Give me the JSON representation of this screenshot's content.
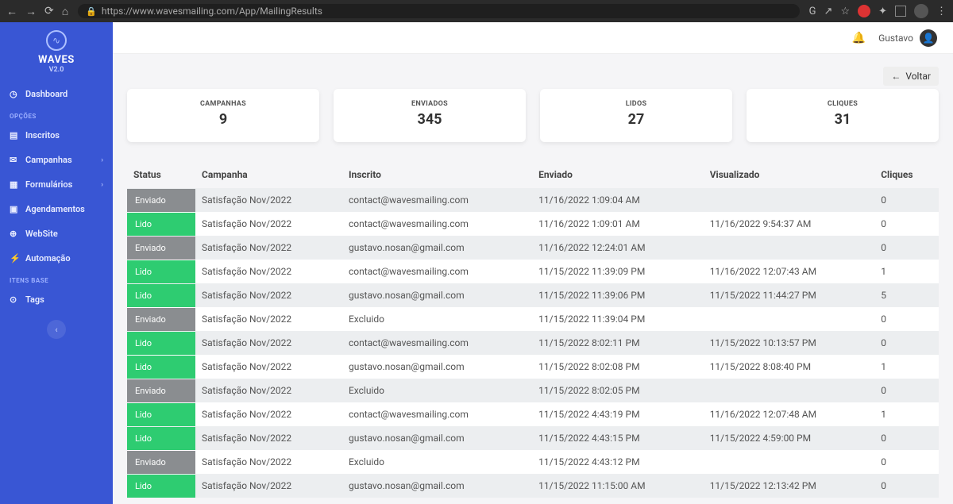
{
  "browser": {
    "url": "https://www.wavesmailing.com/App/MailingResults"
  },
  "brand": {
    "name": "WAVES",
    "version": "V2.0"
  },
  "sidebar": {
    "dashboard": "Dashboard",
    "section_opcoes": "OPÇÕES",
    "inscritos": "Inscritos",
    "campanhas": "Campanhas",
    "formularios": "Formulários",
    "agendamentos": "Agendamentos",
    "website": "WebSite",
    "automacao": "Automação",
    "section_itens": "ITENS BASE",
    "tags": "Tags"
  },
  "topbar": {
    "username": "Gustavo"
  },
  "back": {
    "label": "Voltar"
  },
  "stats": [
    {
      "label": "CAMPANHAS",
      "value": "9"
    },
    {
      "label": "ENVIADOS",
      "value": "345"
    },
    {
      "label": "LIDOS",
      "value": "27"
    },
    {
      "label": "CLIQUES",
      "value": "31"
    }
  ],
  "table": {
    "headers": {
      "status": "Status",
      "campanha": "Campanha",
      "inscrito": "Inscrito",
      "enviado": "Enviado",
      "visualizado": "Visualizado",
      "cliques": "Cliques"
    },
    "rows": [
      {
        "status": "Enviado",
        "campanha": "Satisfação Nov/2022",
        "inscrito": "contact@wavesmailing.com",
        "enviado": "11/16/2022 1:09:04 AM",
        "visualizado": "",
        "cliques": "0"
      },
      {
        "status": "Lido",
        "campanha": "Satisfação Nov/2022",
        "inscrito": "contact@wavesmailing.com",
        "enviado": "11/16/2022 1:09:01 AM",
        "visualizado": "11/16/2022 9:54:37 AM",
        "cliques": "0"
      },
      {
        "status": "Enviado",
        "campanha": "Satisfação Nov/2022",
        "inscrito": "gustavo.nosan@gmail.com",
        "enviado": "11/16/2022 12:24:01 AM",
        "visualizado": "",
        "cliques": "0"
      },
      {
        "status": "Lido",
        "campanha": "Satisfação Nov/2022",
        "inscrito": "contact@wavesmailing.com",
        "enviado": "11/15/2022 11:39:09 PM",
        "visualizado": "11/16/2022 12:07:43 AM",
        "cliques": "1"
      },
      {
        "status": "Lido",
        "campanha": "Satisfação Nov/2022",
        "inscrito": "gustavo.nosan@gmail.com",
        "enviado": "11/15/2022 11:39:06 PM",
        "visualizado": "11/15/2022 11:44:27 PM",
        "cliques": "5"
      },
      {
        "status": "Enviado",
        "campanha": "Satisfação Nov/2022",
        "inscrito": "Excluido",
        "enviado": "11/15/2022 11:39:04 PM",
        "visualizado": "",
        "cliques": "0"
      },
      {
        "status": "Lido",
        "campanha": "Satisfação Nov/2022",
        "inscrito": "contact@wavesmailing.com",
        "enviado": "11/15/2022 8:02:11 PM",
        "visualizado": "11/15/2022 10:13:57 PM",
        "cliques": "0"
      },
      {
        "status": "Lido",
        "campanha": "Satisfação Nov/2022",
        "inscrito": "gustavo.nosan@gmail.com",
        "enviado": "11/15/2022 8:02:08 PM",
        "visualizado": "11/15/2022 8:08:40 PM",
        "cliques": "1"
      },
      {
        "status": "Enviado",
        "campanha": "Satisfação Nov/2022",
        "inscrito": "Excluido",
        "enviado": "11/15/2022 8:02:05 PM",
        "visualizado": "",
        "cliques": "0"
      },
      {
        "status": "Lido",
        "campanha": "Satisfação Nov/2022",
        "inscrito": "contact@wavesmailing.com",
        "enviado": "11/15/2022 4:43:19 PM",
        "visualizado": "11/16/2022 12:07:48 AM",
        "cliques": "1"
      },
      {
        "status": "Lido",
        "campanha": "Satisfação Nov/2022",
        "inscrito": "gustavo.nosan@gmail.com",
        "enviado": "11/15/2022 4:43:15 PM",
        "visualizado": "11/15/2022 4:59:00 PM",
        "cliques": "0"
      },
      {
        "status": "Enviado",
        "campanha": "Satisfação Nov/2022",
        "inscrito": "Excluido",
        "enviado": "11/15/2022 4:43:12 PM",
        "visualizado": "",
        "cliques": "0"
      },
      {
        "status": "Lido",
        "campanha": "Satisfação Nov/2022",
        "inscrito": "gustavo.nosan@gmail.com",
        "enviado": "11/15/2022 11:15:00 AM",
        "visualizado": "11/15/2022 12:13:42 PM",
        "cliques": "0"
      }
    ]
  }
}
